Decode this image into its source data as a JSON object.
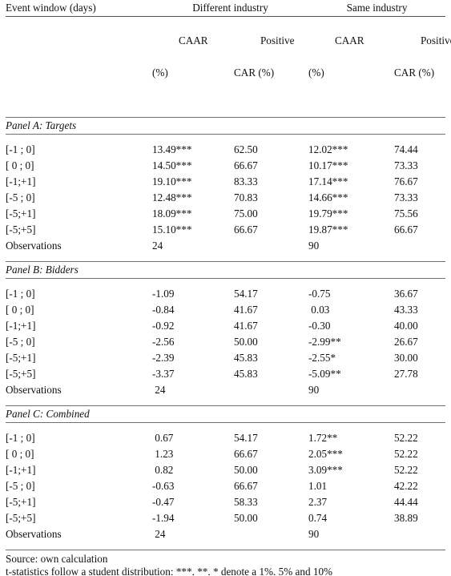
{
  "table": {
    "stub_header": "Event window (days)",
    "group_headers": [
      {
        "label": "Different industry"
      },
      {
        "label": "Same industry"
      }
    ],
    "column_headers": [
      {
        "line1": "CAAR",
        "line2": "(%)"
      },
      {
        "line1": "Positive",
        "line2": "CAR (%)"
      },
      {
        "line1": "CAAR",
        "line2": "(%)"
      },
      {
        "line1": "Positive",
        "line2": "CAR (%)"
      }
    ],
    "observations_label": "Observations",
    "panels": [
      {
        "title": "Panel A: Targets",
        "rows": [
          {
            "window": "[-1 ; 0]",
            "diff_caar": "13.49***",
            "diff_pos": "62.50",
            "same_caar": "12.02***",
            "same_pos": "74.44"
          },
          {
            "window": "[ 0 ; 0]",
            "diff_caar": "14.50***",
            "diff_pos": "66.67",
            "same_caar": "10.17***",
            "same_pos": "73.33"
          },
          {
            "window": "[-1;+1]",
            "diff_caar": "19.10***",
            "diff_pos": "83.33",
            "same_caar": "17.14***",
            "same_pos": "76.67"
          },
          {
            "window": "[-5 ; 0]",
            "diff_caar": "12.48***",
            "diff_pos": "70.83",
            "same_caar": "14.66***",
            "same_pos": "73.33"
          },
          {
            "window": "[-5;+1]",
            "diff_caar": "18.09***",
            "diff_pos": "75.00",
            "same_caar": "19.79***",
            "same_pos": "75.56"
          },
          {
            "window": "[-5;+5]",
            "diff_caar": "15.10***",
            "diff_pos": "66.67",
            "same_caar": "19.87***",
            "same_pos": "66.67"
          }
        ],
        "observations_diff": "24",
        "observations_same": "90"
      },
      {
        "title": "Panel B: Bidders",
        "rows": [
          {
            "window": "[-1 ; 0]",
            "diff_caar": "-1.09",
            "diff_pos": "54.17",
            "same_caar": "-0.75",
            "same_pos": "36.67"
          },
          {
            "window": "[ 0 ; 0]",
            "diff_caar": "-0.84",
            "diff_pos": "41.67",
            "same_caar": " 0.03",
            "same_pos": "43.33"
          },
          {
            "window": "[-1;+1]",
            "diff_caar": "-0.92",
            "diff_pos": "41.67",
            "same_caar": "-0.30",
            "same_pos": "40.00"
          },
          {
            "window": "[-5 ; 0]",
            "diff_caar": "-2.56",
            "diff_pos": "50.00",
            "same_caar": "-2.99**",
            "same_pos": "26.67"
          },
          {
            "window": "[-5;+1]",
            "diff_caar": "-2.39",
            "diff_pos": "45.83",
            "same_caar": "-2.55*",
            "same_pos": "30.00"
          },
          {
            "window": "[-5;+5]",
            "diff_caar": "-3.37",
            "diff_pos": "45.83",
            "same_caar": "-5.09**",
            "same_pos": "27.78"
          }
        ],
        "observations_diff": " 24",
        "observations_same": "90"
      },
      {
        "title": "Panel C: Combined",
        "rows": [
          {
            "window": "[-1 ; 0]",
            "diff_caar": " 0.67",
            "diff_pos": "54.17",
            "same_caar": "1.72**",
            "same_pos": "52.22"
          },
          {
            "window": "[ 0 ; 0]",
            "diff_caar": " 1.23",
            "diff_pos": "66.67",
            "same_caar": "2.05***",
            "same_pos": "52.22"
          },
          {
            "window": "[-1;+1]",
            "diff_caar": " 0.82",
            "diff_pos": "50.00",
            "same_caar": "3.09***",
            "same_pos": "52.22"
          },
          {
            "window": "[-5 ; 0]",
            "diff_caar": "-0.63",
            "diff_pos": "66.67",
            "same_caar": "1.01",
            "same_pos": "42.22"
          },
          {
            "window": "[-5;+1]",
            "diff_caar": "-0.47",
            "diff_pos": "58.33",
            "same_caar": "2.37",
            "same_pos": "44.44"
          },
          {
            "window": "[-5;+5]",
            "diff_caar": "-1.94",
            "diff_pos": "50.00",
            "same_caar": "0.74",
            "same_pos": "38.89"
          }
        ],
        "observations_diff": " 24",
        "observations_same": "90"
      }
    ],
    "footer": {
      "source": "Source: own calculation",
      "note": "t-statistics follow a student distribution; ***, **, * denote a 1%, 5% and 10%"
    }
  }
}
